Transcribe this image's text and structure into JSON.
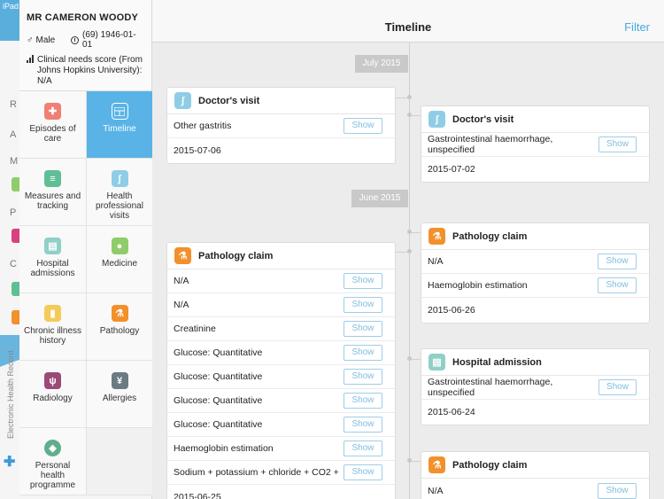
{
  "underlay": {
    "device_label": "iPad",
    "letters": [
      "R",
      "A",
      "M",
      "P",
      "C"
    ],
    "vertical_label": "Electronic Health Record"
  },
  "patient": {
    "name": "MR CAMERON WOODY",
    "gender": "Male",
    "dob": "(69) 1946-01-01",
    "score_text": "Clinical needs score (From Johns Hopkins University): N/A"
  },
  "nav": [
    {
      "label": "Episodes of care",
      "icon": "first-aid-kit-icon",
      "color": "#f07f74"
    },
    {
      "label": "Timeline",
      "icon": "timeline-icon",
      "color": "#59b3e6",
      "active": true
    },
    {
      "label": "Measures and tracking",
      "icon": "clipboard-icon",
      "color": "#5fbf94"
    },
    {
      "label": "Health professional visits",
      "icon": "stethoscope-icon",
      "color": "#8fcde6"
    },
    {
      "label": "Hospital admissions",
      "icon": "hospital-icon",
      "color": "#8fd0c8"
    },
    {
      "label": "Medicine",
      "icon": "pills-icon",
      "color": "#8fcc6a"
    },
    {
      "label": "Chronic illness history",
      "icon": "bottle-icon",
      "color": "#f4cb5a"
    },
    {
      "label": "Pathology",
      "icon": "microscope-icon",
      "color": "#f2902c"
    },
    {
      "label": "Radiology",
      "icon": "lungs-icon",
      "color": "#9b4a78"
    },
    {
      "label": "Allergies",
      "icon": "wheat-icon",
      "color": "#6b7b82"
    },
    {
      "label": "Personal health programme",
      "icon": "shield-icon",
      "color": "#5fae8c"
    }
  ],
  "header": {
    "title": "Timeline",
    "filter_label": "Filter"
  },
  "show_label": "Show",
  "months": [
    "July 2015",
    "June 2015"
  ],
  "cards": [
    {
      "title": "Doctor's visit",
      "icon": "stethoscope-icon",
      "color": "#8fcde6",
      "rows": [
        "Other gastritis"
      ],
      "date": "2015-07-06"
    },
    {
      "title": "Doctor's visit",
      "icon": "stethoscope-icon",
      "color": "#8fcde6",
      "rows": [
        "Gastrointestinal haemorrhage, unspecified"
      ],
      "date": "2015-07-02"
    },
    {
      "title": "Pathology claim",
      "icon": "microscope-icon",
      "color": "#f2902c",
      "rows": [
        "N/A",
        "N/A",
        "Creatinine",
        "Glucose: Quantitative",
        "Glucose: Quantitative",
        "Glucose: Quantitative",
        "Glucose: Quantitative",
        "Haemoglobin estimation",
        "Sodium + potassium + chloride + CO2 +"
      ],
      "date": "2015-06-25"
    },
    {
      "title": "Pathology claim",
      "icon": "microscope-icon",
      "color": "#f2902c",
      "rows": [
        "N/A",
        "Haemoglobin estimation"
      ],
      "date": "2015-06-26"
    },
    {
      "title": "Hospital admission",
      "icon": "hospital-icon",
      "color": "#8fd0c8",
      "rows": [
        "Gastrointestinal haemorrhage, unspecified"
      ],
      "date": "2015-06-24"
    },
    {
      "title": "Pathology claim",
      "icon": "microscope-icon",
      "color": "#f2902c",
      "rows": [
        "N/A"
      ],
      "date": ""
    }
  ]
}
